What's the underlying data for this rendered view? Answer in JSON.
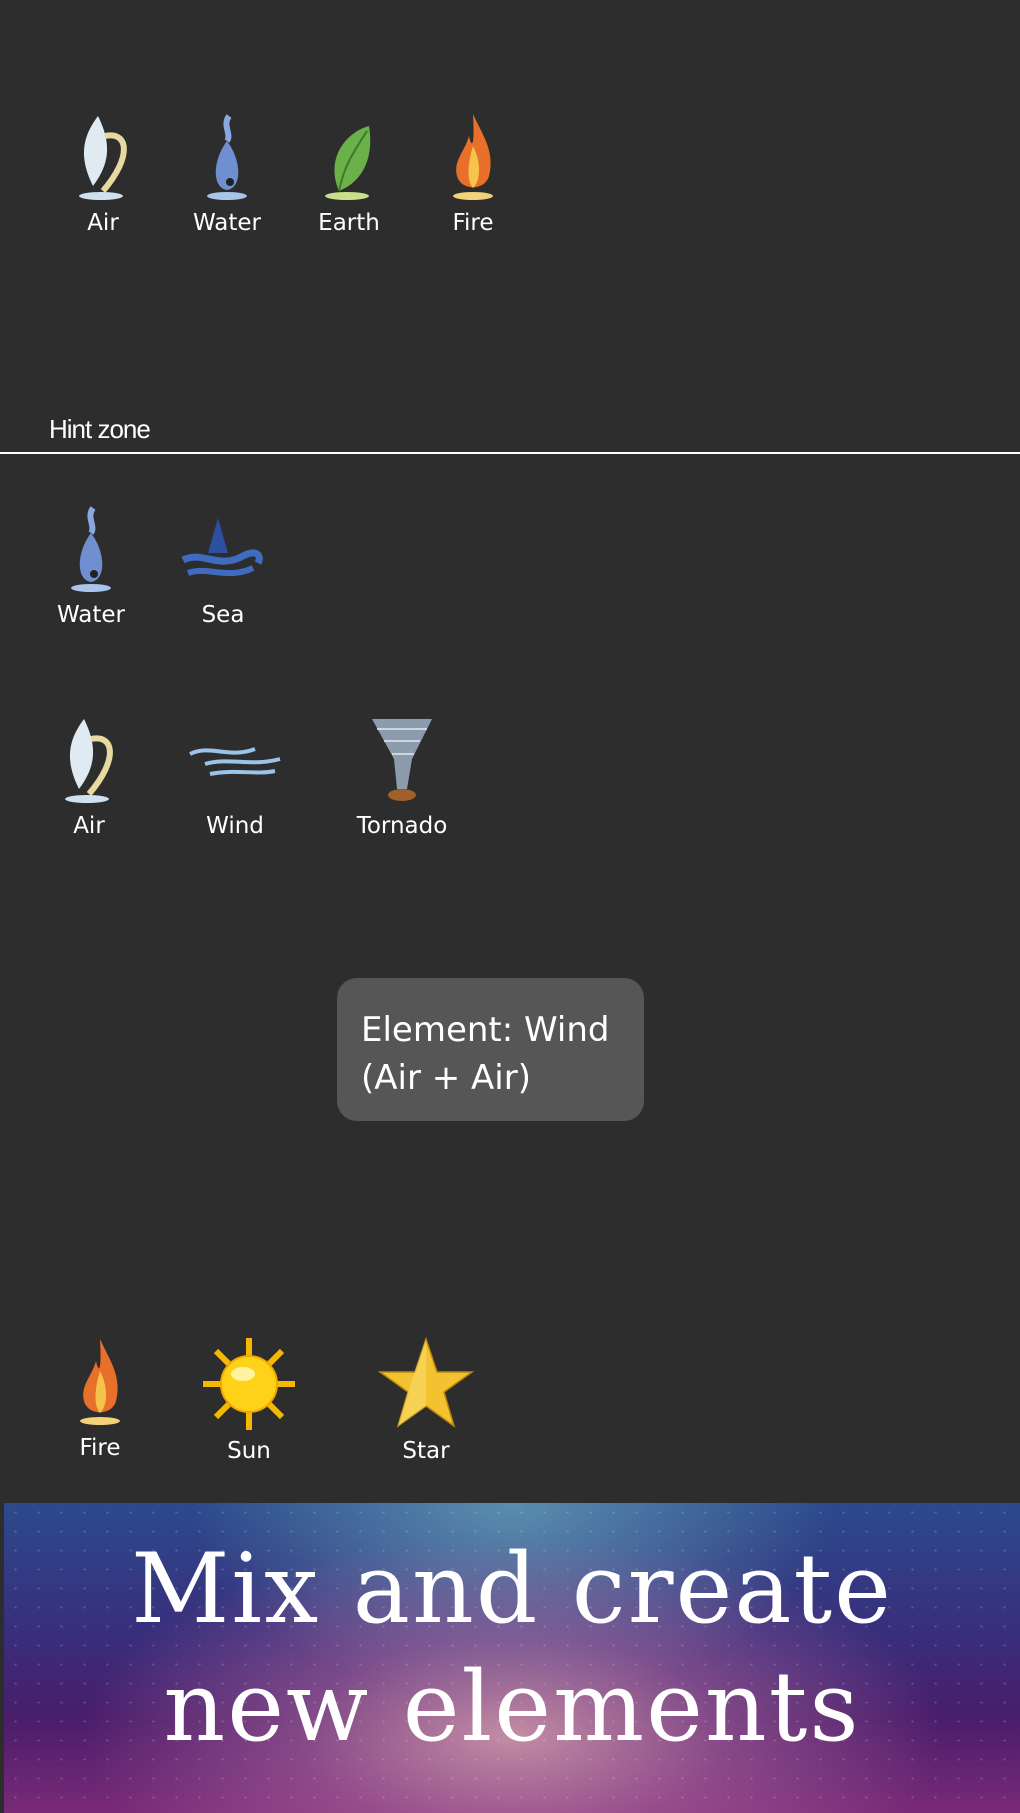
{
  "palette": {
    "elements": [
      {
        "name": "Air",
        "icon": "air-icon"
      },
      {
        "name": "Water",
        "icon": "water-icon"
      },
      {
        "name": "Earth",
        "icon": "earth-icon"
      },
      {
        "name": "Fire",
        "icon": "fire-icon"
      }
    ]
  },
  "hint_zone": {
    "label": "Hint zone",
    "rows": [
      [
        {
          "name": "Water",
          "icon": "water-icon"
        },
        {
          "name": "Sea",
          "icon": "sea-icon"
        }
      ],
      [
        {
          "name": "Air",
          "icon": "air-icon"
        },
        {
          "name": "Wind",
          "icon": "wind-icon"
        },
        {
          "name": "Tornado",
          "icon": "tornado-icon"
        }
      ],
      [
        {
          "name": "Fire",
          "icon": "fire-icon"
        },
        {
          "name": "Sun",
          "icon": "sun-icon"
        },
        {
          "name": "Star",
          "icon": "star-icon"
        }
      ]
    ],
    "tooltip": {
      "line1": "Element: Wind",
      "line2": "(Air + Air)"
    }
  },
  "banner": {
    "line1": "Mix and create",
    "line2": "new elements"
  },
  "colors": {
    "background": "#2d2d2d",
    "tooltip": "#565656"
  }
}
